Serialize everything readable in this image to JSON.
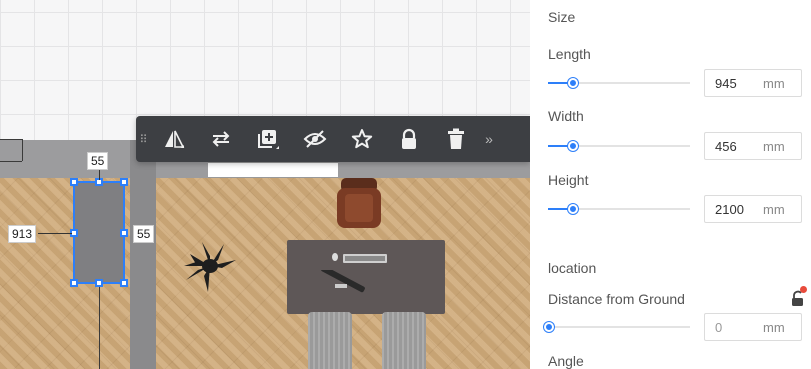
{
  "canvas": {
    "dimensions": {
      "top_width": "55",
      "right_width": "55",
      "left_length": "913"
    }
  },
  "toolbar": {
    "grip": "⠿",
    "tools": [
      {
        "name": "mirror-icon",
        "glyph": "◭"
      },
      {
        "name": "swap-icon",
        "glyph": "⇄"
      },
      {
        "name": "add-layer-icon",
        "glyph": "⊞"
      },
      {
        "name": "hide-icon",
        "glyph": "⊘"
      },
      {
        "name": "favorite-icon",
        "glyph": "☆"
      },
      {
        "name": "lock-icon",
        "glyph": "🔒"
      },
      {
        "name": "delete-icon",
        "glyph": "🗑"
      }
    ],
    "more": "»"
  },
  "panel": {
    "size_heading": "Size",
    "length": {
      "label": "Length",
      "value": "945",
      "unit": "mm",
      "fraction": 0.13
    },
    "width": {
      "label": "Width",
      "value": "456",
      "unit": "mm",
      "fraction": 0.13
    },
    "height": {
      "label": "Height",
      "value": "2100",
      "unit": "mm",
      "fraction": 0.13
    },
    "location_heading": "location",
    "ground": {
      "label": "Distance from Ground",
      "value": "0",
      "unit": "mm",
      "fraction": 0.0
    },
    "angle_label": "Angle"
  },
  "colors": {
    "accent": "#2d7ff9",
    "toolbar_bg": "#3d3f43",
    "wood": "#cfaa79",
    "lock_dot": "#e84b3c"
  }
}
